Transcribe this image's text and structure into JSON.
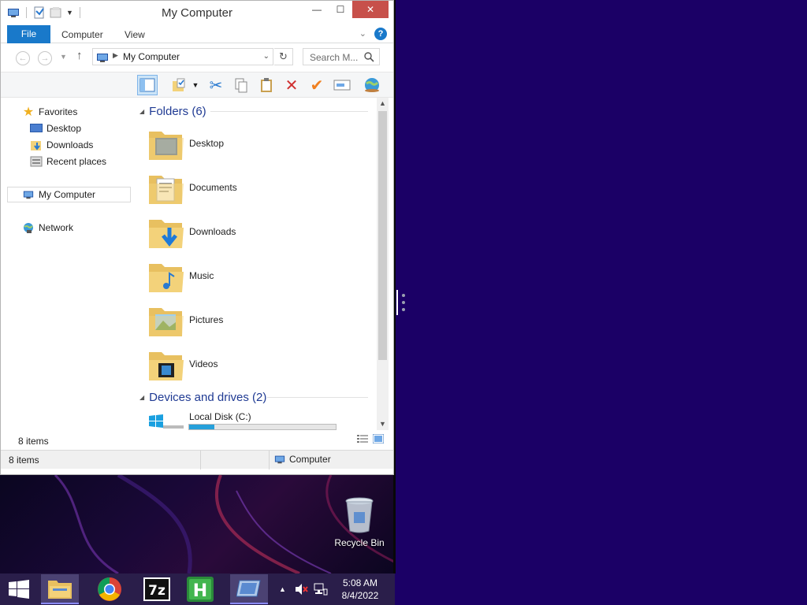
{
  "window": {
    "title": "My Computer",
    "controls": {
      "minimize": "—",
      "maximize": "☐",
      "close": "✕"
    }
  },
  "ribbon": {
    "file": "File",
    "tabs": [
      "Computer",
      "View"
    ],
    "help": "?"
  },
  "address": {
    "path": "My Computer",
    "search_placeholder": "Search M..."
  },
  "nav": {
    "favorites": "Favorites",
    "desktop": "Desktop",
    "downloads": "Downloads",
    "recent": "Recent places",
    "computer": "My Computer",
    "network": "Network"
  },
  "content": {
    "folders_header": "Folders (6)",
    "folders": [
      "Desktop",
      "Documents",
      "Downloads",
      "Music",
      "Pictures",
      "Videos"
    ],
    "devices_header": "Devices and drives (2)",
    "drive_name": "Local Disk (C:)",
    "drive_used_fraction": 0.17
  },
  "status": {
    "inner_count": "8 items",
    "count": "8 items",
    "location": "Computer"
  },
  "desktop": {
    "recycle_bin": "Recycle Bin"
  },
  "taskbar": {
    "time": "5:08 AM",
    "date": "8/4/2022"
  },
  "colors": {
    "accent": "#1979ca",
    "desktop_right": "#1b0066",
    "taskbar": "#2a1e4a",
    "folder_yellow": "#f3d27a",
    "close_button": "#c7504a"
  }
}
